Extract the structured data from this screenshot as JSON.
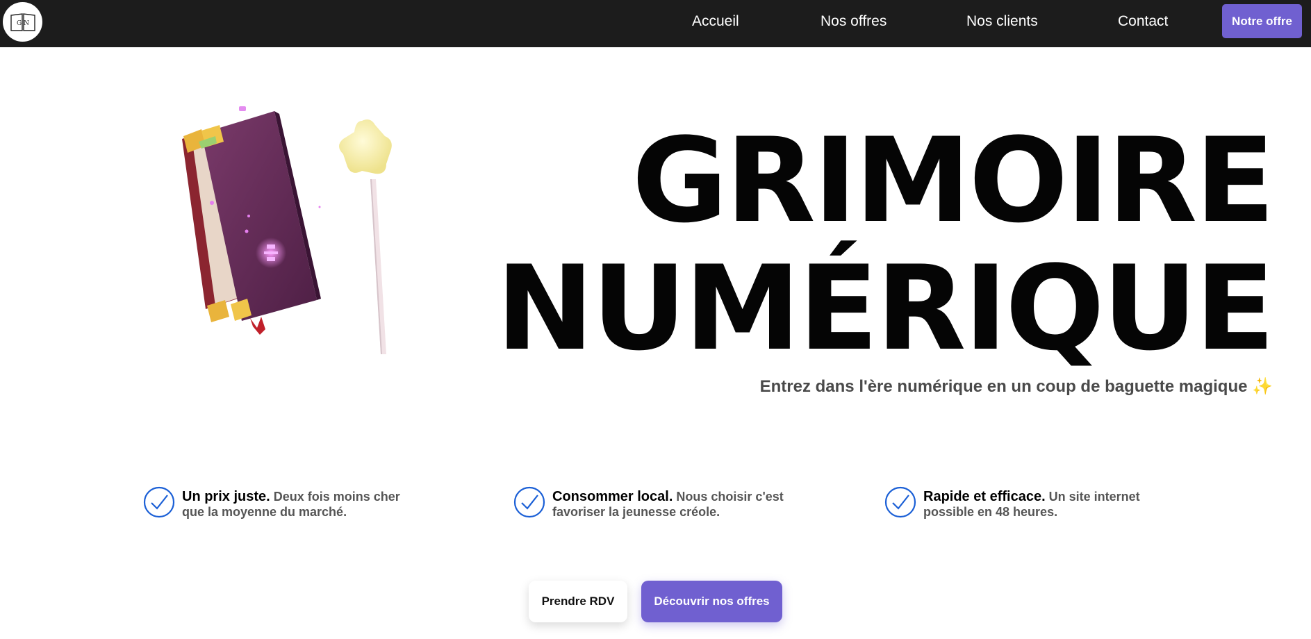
{
  "navbar": {
    "logo_text": "G N",
    "links": [
      {
        "label": "Accueil"
      },
      {
        "label": "Nos offres"
      },
      {
        "label": "Nos clients"
      },
      {
        "label": "Contact"
      }
    ],
    "cta_label": "Notre offre"
  },
  "hero": {
    "title_line1": "GRIMOIRE",
    "title_line2": "NUMÉRIQUE",
    "subtitle": "Entrez dans l'ère numérique en un coup de baguette magique ✨"
  },
  "features": [
    {
      "title": "Un prix juste.",
      "text": "Deux fois moins cher que la moyenne du marché."
    },
    {
      "title": "Consommer local.",
      "text": "Nous choisir c'est favoriser la jeunesse créole."
    },
    {
      "title": "Rapide et efficace.",
      "text": "Un site internet possible en 48 heures."
    }
  ],
  "buttons": {
    "secondary_label": "Prendre RDV",
    "primary_label": "Découvrir nos offres"
  },
  "colors": {
    "navbar_bg": "#1c1c1c",
    "accent": "#7060d0",
    "check": "#1a5fd6"
  }
}
